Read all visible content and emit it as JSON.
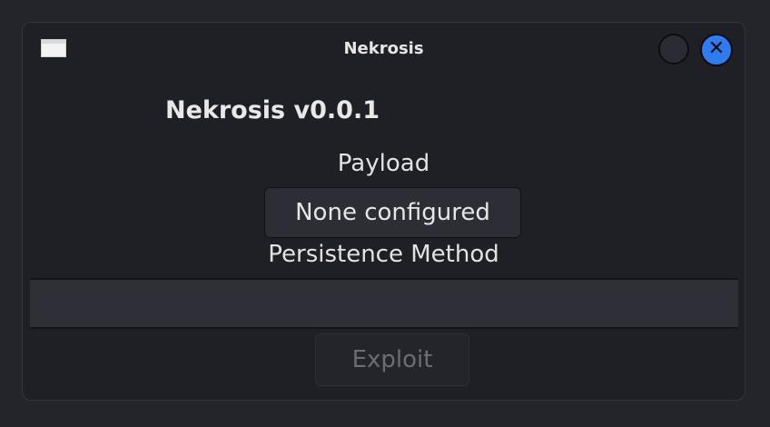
{
  "window": {
    "title": "Nekrosis",
    "icons": {
      "app": "window-icon",
      "minimize": "circle-icon",
      "close": "x-icon"
    },
    "close_glyph": "✕"
  },
  "main": {
    "heading": "Nekrosis v0.0.1",
    "payload_label": "Payload",
    "payload_button": "None configured",
    "persistence_label": "Persistence Method",
    "persistence_value": "",
    "exploit_button": "Exploit",
    "exploit_enabled": false
  },
  "colors": {
    "accent": "#2f7cf0",
    "background": "#24252b",
    "window": "#1f2026"
  }
}
